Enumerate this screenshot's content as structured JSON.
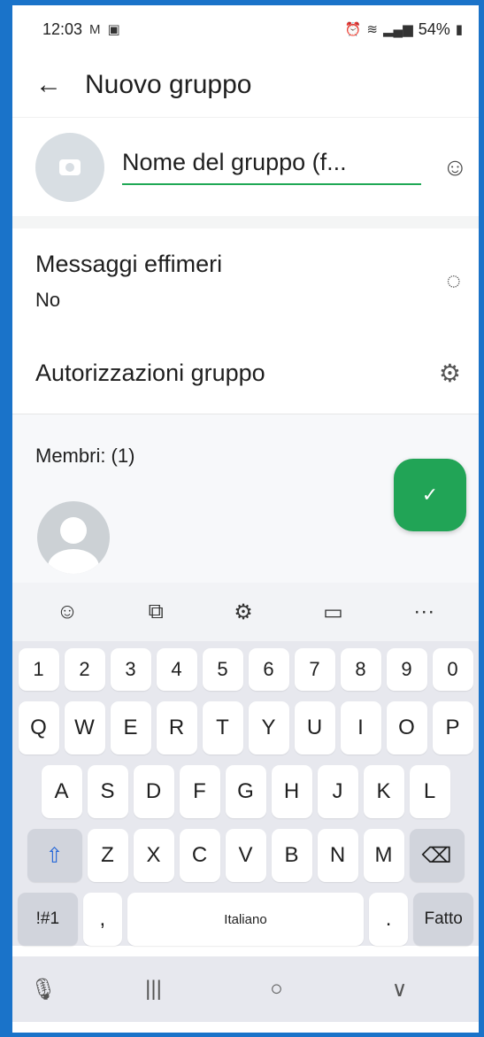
{
  "status": {
    "time": "12:03",
    "left_icons": [
      "M",
      "▣"
    ],
    "battery": "54%"
  },
  "appbar": {
    "back": "←",
    "title": "Nuovo gruppo"
  },
  "group": {
    "name_placeholder": "Nome del gruppo (f...",
    "emoji": "☺"
  },
  "settings": [
    {
      "label": "Messaggi effimeri",
      "value": "No",
      "icon": "◌"
    },
    {
      "label": "Autorizzazioni gruppo",
      "icon": "⚙"
    }
  ],
  "members": {
    "label": "Membri: (1)"
  },
  "fab": {
    "icon": "✓"
  },
  "keyboard": {
    "toolbar": [
      "☺",
      "⧉",
      "⚙",
      "▭",
      "···"
    ],
    "numbers": [
      "1",
      "2",
      "3",
      "4",
      "5",
      "6",
      "7",
      "8",
      "9",
      "0"
    ],
    "row1": [
      "Q",
      "W",
      "E",
      "R",
      "T",
      "Y",
      "U",
      "I",
      "O",
      "P"
    ],
    "row2": [
      "A",
      "S",
      "D",
      "F",
      "G",
      "H",
      "J",
      "K",
      "L"
    ],
    "row3": [
      "Z",
      "X",
      "C",
      "V",
      "B",
      "N",
      "M"
    ],
    "shift": "⇧",
    "backspace": "⌫",
    "sym": "!#1",
    "comma": ",",
    "space": "Italiano",
    "period": ".",
    "done": "Fatto"
  },
  "navbar": {
    "mic": "🎙",
    "recent": "|||",
    "home": "○",
    "back": "∨"
  }
}
